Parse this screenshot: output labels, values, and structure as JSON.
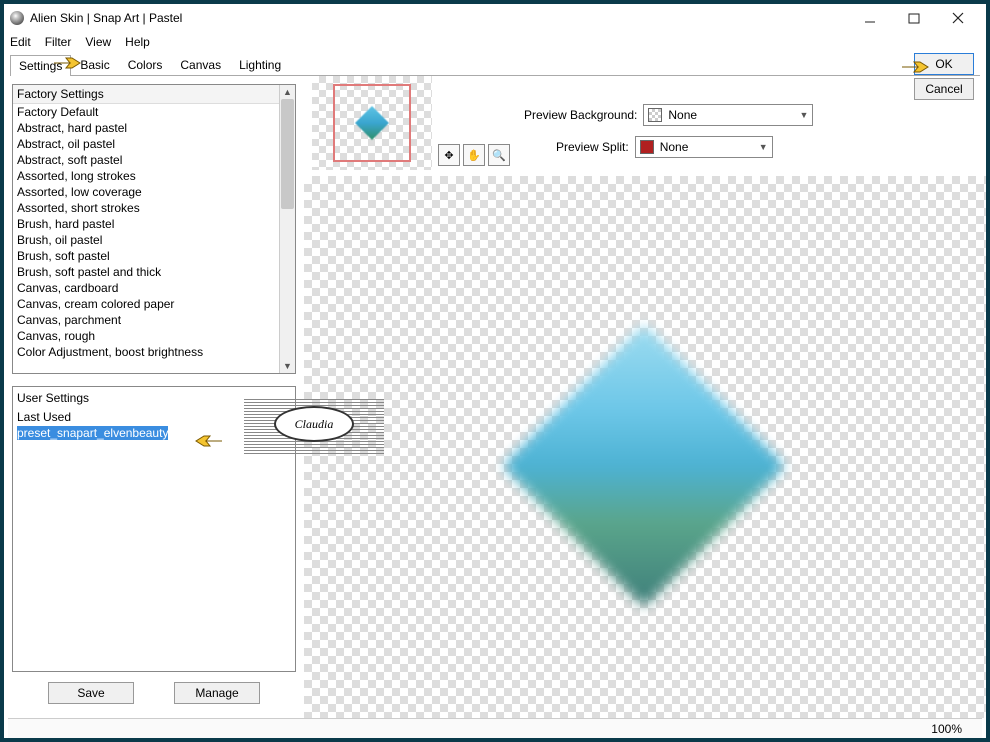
{
  "window": {
    "title": "Alien Skin | Snap Art | Pastel"
  },
  "menu": {
    "edit": "Edit",
    "filter": "Filter",
    "view": "View",
    "help": "Help"
  },
  "tabs": {
    "settings": "Settings",
    "basic": "Basic",
    "colors": "Colors",
    "canvas": "Canvas",
    "lighting": "Lighting"
  },
  "factory": {
    "header": "Factory Settings",
    "items": [
      "Factory Default",
      "Abstract, hard pastel",
      "Abstract, oil pastel",
      "Abstract, soft pastel",
      "Assorted, long strokes",
      "Assorted, low coverage",
      "Assorted, short strokes",
      "Brush, hard pastel",
      "Brush, oil pastel",
      "Brush, soft pastel",
      "Brush, soft pastel and thick",
      "Canvas, cardboard",
      "Canvas, cream colored paper",
      "Canvas, parchment",
      "Canvas, rough",
      "Color Adjustment, boost brightness"
    ]
  },
  "user": {
    "header": "User Settings",
    "last_used": "Last Used",
    "selected": "preset_snapart_elvenbeauty"
  },
  "buttons": {
    "save": "Save",
    "manage": "Manage",
    "ok": "OK",
    "cancel": "Cancel"
  },
  "preview": {
    "bg_label": "Preview Background:",
    "bg_value": "None",
    "split_label": "Preview Split:",
    "split_value": "None",
    "split_color": "#b02020"
  },
  "watermark": {
    "text": "Claudia"
  },
  "status": {
    "zoom": "100%"
  }
}
